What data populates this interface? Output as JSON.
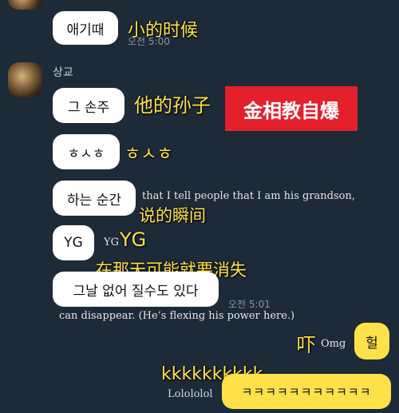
{
  "messages": {
    "m1": {
      "text": "애기때",
      "time": "오전 5:00"
    },
    "sender_name": "상교",
    "m2": {
      "text": "그 손주"
    },
    "m3": {
      "text": "ㅎㅅㅎ"
    },
    "m4": {
      "text": "하는 순간"
    },
    "m5": {
      "text": "YG"
    },
    "m6": {
      "text": "그날 없어 질수도 있다",
      "time": "오전 5:01"
    },
    "me1": {
      "text": "헐"
    },
    "me2": {
      "text": "ㅋㅋㅋㅋㅋㅋㅋㅋㅋㅋㅋ"
    }
  },
  "annotations": {
    "a1": "小的时候",
    "a2": "他的孙子",
    "a3": "ㅎㅅㅎ",
    "a4": "说的瞬间",
    "a5": "YG",
    "a6": "在那天可能就要消失",
    "a7": "吓",
    "a8": "kkkkkkkkkk"
  },
  "title_box": {
    "text": "金相教自爆",
    "color": "#e3202c"
  },
  "english": {
    "e1": "that I tell people that I am his grandson,",
    "e2": "YG",
    "e3": "can disappear. (He’s flexing his power here.)",
    "e4": "Omg",
    "e5": "Lolololol"
  },
  "colors": {
    "background": "#1d2a38",
    "my_bubble": "#ffe14a",
    "annotation": "#ffe24a"
  }
}
